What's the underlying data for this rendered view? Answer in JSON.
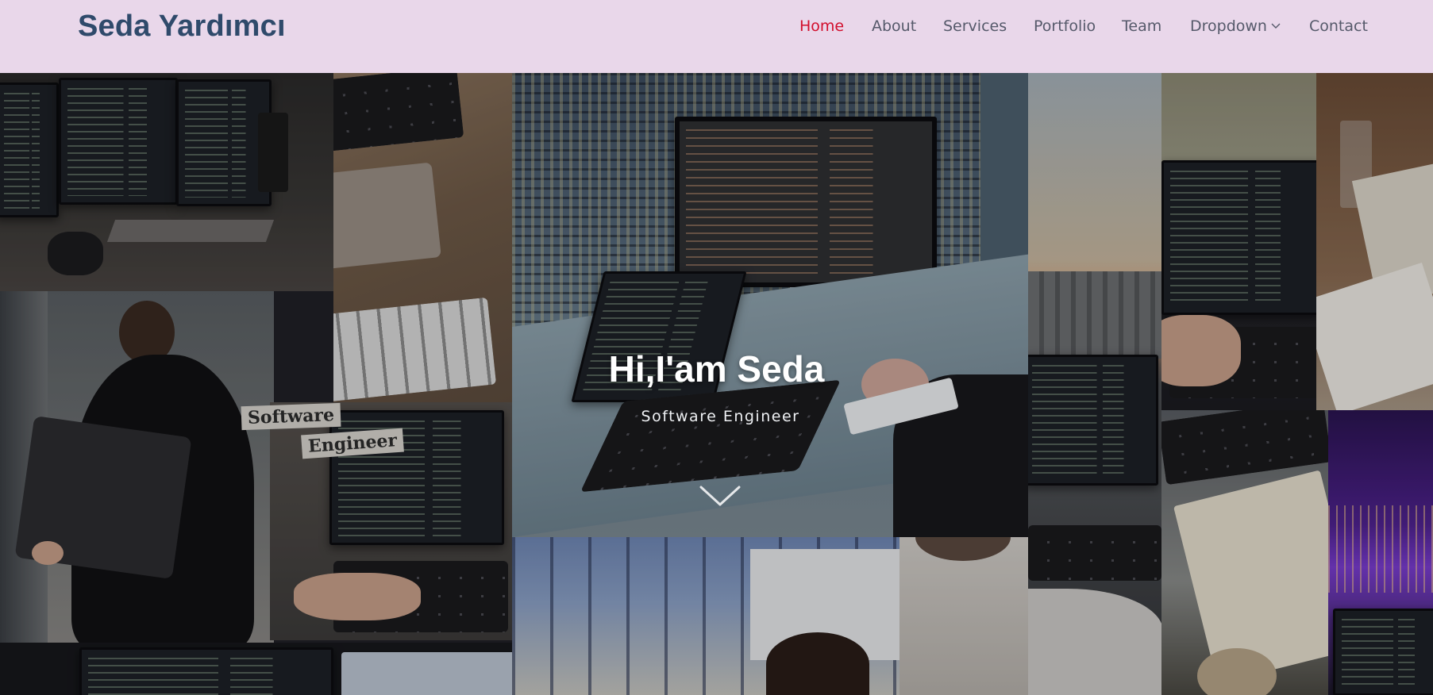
{
  "header": {
    "logo": "Seda Yardımcı",
    "nav": [
      {
        "label": "Home",
        "active": true
      },
      {
        "label": "About"
      },
      {
        "label": "Services"
      },
      {
        "label": "Portfolio"
      },
      {
        "label": "Team"
      },
      {
        "label": "Dropdown"
      },
      {
        "label": "Contact"
      }
    ]
  },
  "hero": {
    "title": "Hi,I'am Seda",
    "subtitle": "Software Engineer",
    "sticker_line1": "Software",
    "sticker_line2": "Engineer"
  },
  "colors": {
    "header_bg": "#e9d7ea",
    "logo": "#2f4a6b",
    "nav_text": "#55596a",
    "nav_active": "#d20e2c"
  },
  "icons": {
    "dropdown": "chevron-down-icon",
    "scroll": "chevron-down-icon"
  }
}
